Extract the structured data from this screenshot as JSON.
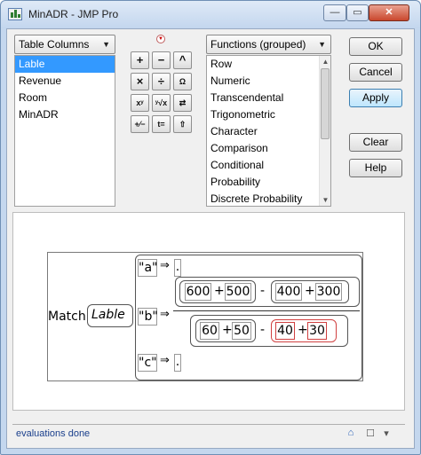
{
  "window": {
    "title": "MinADR - JMP Pro",
    "minimize": "—",
    "maximize": "▭",
    "close": "✕"
  },
  "columns_dropdown": {
    "label": "Table Columns",
    "arrow": "▼"
  },
  "columns": [
    {
      "label": "Lable",
      "selected": true
    },
    {
      "label": "Revenue",
      "selected": false
    },
    {
      "label": "Room",
      "selected": false
    },
    {
      "label": "MinADR",
      "selected": false
    }
  ],
  "keypad": {
    "plus": "+",
    "minus": "−",
    "raise": "^",
    "times": "×",
    "divide": "÷",
    "assign": "Ω",
    "power": "xʸ",
    "root": "ʸ√x",
    "swap": "⇄",
    "plusminus": "+⁄−",
    "equals": "t=",
    "shift": "⇧"
  },
  "functions_dropdown": {
    "label": "Functions (grouped)",
    "arrow": "▼"
  },
  "functions": [
    "Row",
    "Numeric",
    "Transcendental",
    "Trigonometric",
    "Character",
    "Comparison",
    "Conditional",
    "Probability",
    "Discrete Probability"
  ],
  "buttons": {
    "ok": "OK",
    "cancel": "Cancel",
    "apply": "Apply",
    "clear": "Clear",
    "help": "Help"
  },
  "formula": {
    "function": "Match",
    "argument": "Lable",
    "cases": [
      {
        "key": "\"a\"",
        "arrow": "⇒",
        "result": "."
      },
      {
        "key": "\"b\"",
        "arrow": "⇒"
      },
      {
        "key": "\"c\"",
        "arrow": "⇒",
        "result": "."
      }
    ],
    "numerator": {
      "a": "600",
      "plus1": "+",
      "b": "500",
      "minus": "-",
      "c": "400",
      "plus2": "+",
      "d": "300"
    },
    "denominator": {
      "a": "60",
      "plus1": "+",
      "b": "50",
      "minus": "-",
      "c": "40",
      "plus2": "+",
      "d": "30"
    }
  },
  "status": {
    "text": "evaluations done",
    "home_icon": "⌂",
    "check_icon": "☐",
    "menu_icon": "▾"
  }
}
